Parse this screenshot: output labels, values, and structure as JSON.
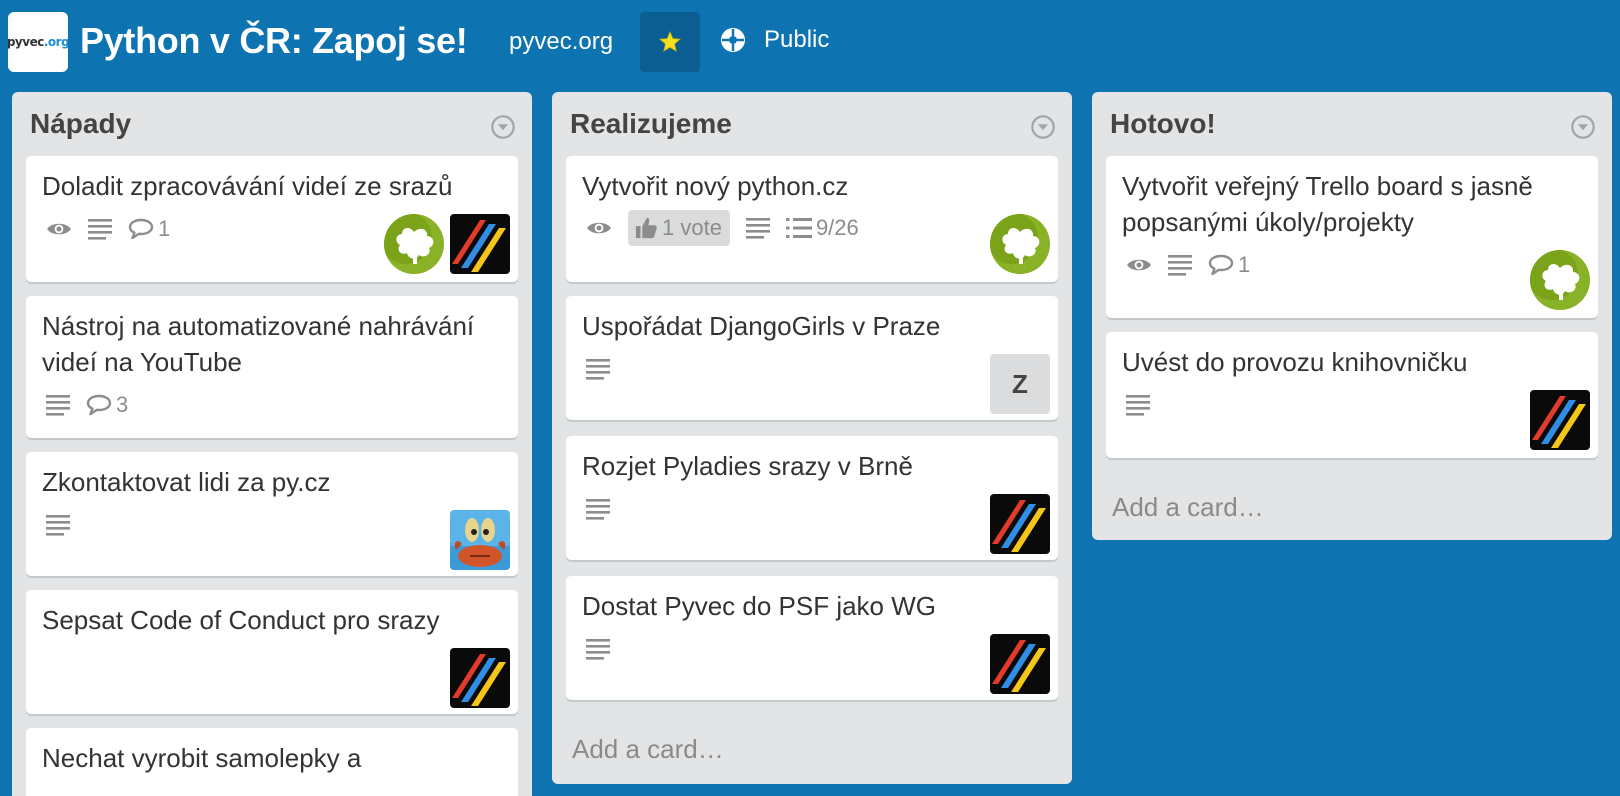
{
  "header": {
    "logo_text_main": "pyvec",
    "logo_text_org": ".org",
    "board_title": "Python v ČR: Zapoj se!",
    "org_name": "pyvec.org",
    "star_icon": "star-icon",
    "visibility_label": "Public",
    "colors": {
      "background": "#0e74b1",
      "star": "#f5e020"
    }
  },
  "lists": [
    {
      "title": "Nápady",
      "cards": [
        {
          "title": "Doladit zpracovávání videí ze srazů",
          "comments": "1",
          "avatars": [
            "green-leaf",
            "stripes"
          ]
        },
        {
          "title": "Nástroj na automatizované nahrávání videí na YouTube",
          "comments": "3",
          "avatars": []
        },
        {
          "title": "Zkontaktovat lidi za py.cz",
          "avatars": [
            "crab"
          ]
        },
        {
          "title": "Sepsat Code of Conduct pro srazy",
          "avatars": [
            "stripes"
          ]
        },
        {
          "title": "Nechat vyrobit samolepky a",
          "avatars": []
        }
      ]
    },
    {
      "title": "Realizujeme",
      "cards": [
        {
          "title": "Vytvořit nový python.cz",
          "votes": "1 vote",
          "checklist": "9/26",
          "avatars": [
            "green-leaf"
          ]
        },
        {
          "title": "Uspořádat DjangoGirls v Praze",
          "avatar_initial": "Z"
        },
        {
          "title": "Rozjet Pyladies srazy v Brně",
          "avatars": [
            "stripes"
          ]
        },
        {
          "title": "Dostat Pyvec do PSF jako WG",
          "avatars": [
            "stripes"
          ]
        }
      ],
      "add_card": "Add a card…"
    },
    {
      "title": "Hotovo!",
      "cards": [
        {
          "title": "Vytvořit veřejný Trello board s jasně popsanými úkoly/projekty",
          "comments": "1",
          "avatars": [
            "green-leaf"
          ]
        },
        {
          "title": "Uvést do provozu knihovničku",
          "avatars": [
            "stripes"
          ]
        }
      ],
      "add_card": "Add a card…"
    }
  ]
}
